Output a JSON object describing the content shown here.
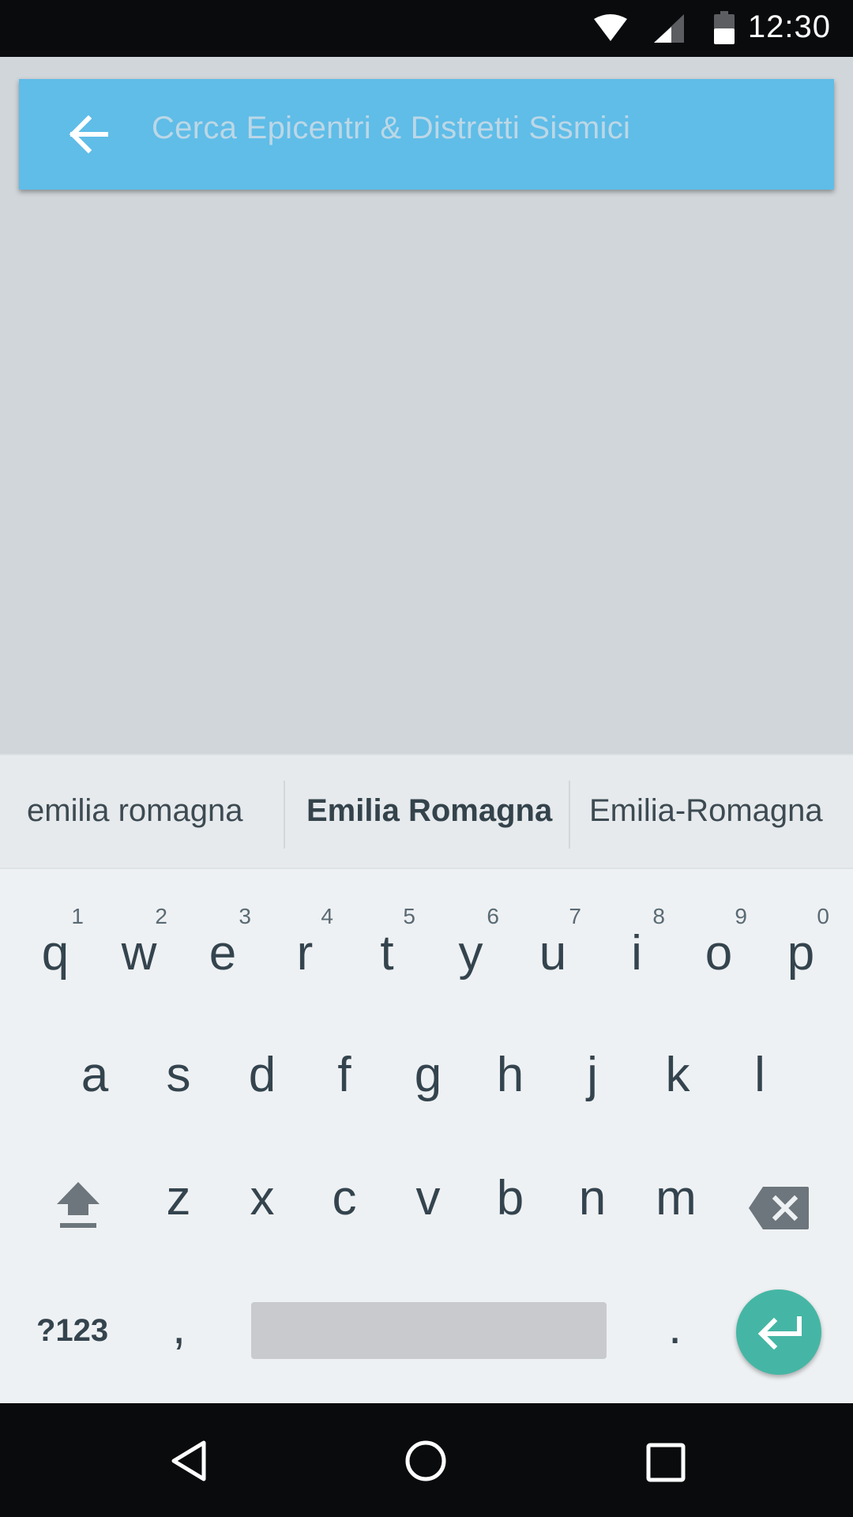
{
  "status_bar": {
    "time": "12:30",
    "icons": [
      "wifi-icon",
      "cell-signal-icon",
      "battery-icon"
    ]
  },
  "search": {
    "placeholder": "Cerca Epicentri & Distretti Sismici",
    "back_icon": "arrow-back-icon"
  },
  "suggestions": [
    "emilia romagna",
    "Emilia Romagna",
    "Emilia-Romagna"
  ],
  "keyboard": {
    "row1": [
      {
        "key": "q",
        "hint": "1"
      },
      {
        "key": "w",
        "hint": "2"
      },
      {
        "key": "e",
        "hint": "3"
      },
      {
        "key": "r",
        "hint": "4"
      },
      {
        "key": "t",
        "hint": "5"
      },
      {
        "key": "y",
        "hint": "6"
      },
      {
        "key": "u",
        "hint": "7"
      },
      {
        "key": "i",
        "hint": "8"
      },
      {
        "key": "o",
        "hint": "9"
      },
      {
        "key": "p",
        "hint": "0"
      }
    ],
    "row2": [
      "a",
      "s",
      "d",
      "f",
      "g",
      "h",
      "j",
      "k",
      "l"
    ],
    "row3": [
      "z",
      "x",
      "c",
      "v",
      "b",
      "n",
      "m"
    ],
    "symbols_label": "?123",
    "comma": ",",
    "period": ".",
    "shift_icon": "shift-icon",
    "backspace_icon": "backspace-icon",
    "enter_icon": "enter-icon"
  },
  "colors": {
    "accent_search": "#5fbde8",
    "enter_fab": "#45b6a5",
    "key_text": "#34444e"
  },
  "nav_bar": {
    "icons": [
      "back-triangle-icon",
      "home-circle-icon",
      "recents-square-icon"
    ]
  }
}
